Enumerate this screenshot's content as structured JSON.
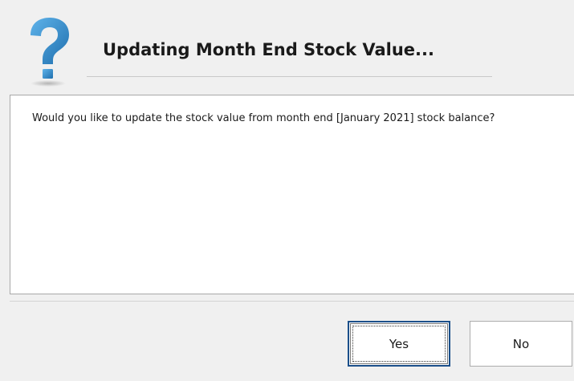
{
  "dialog": {
    "title": "Updating Month End Stock Value...",
    "icon": "question-icon",
    "message": "Would you like to update the stock value from month end [January 2021] stock balance?",
    "buttons": {
      "yes_label": "Yes",
      "no_label": "No"
    },
    "colors": {
      "icon_primary": "#2f86c7",
      "icon_shadow": "#1f5f93",
      "focus_border": "#1b4f8a"
    }
  }
}
